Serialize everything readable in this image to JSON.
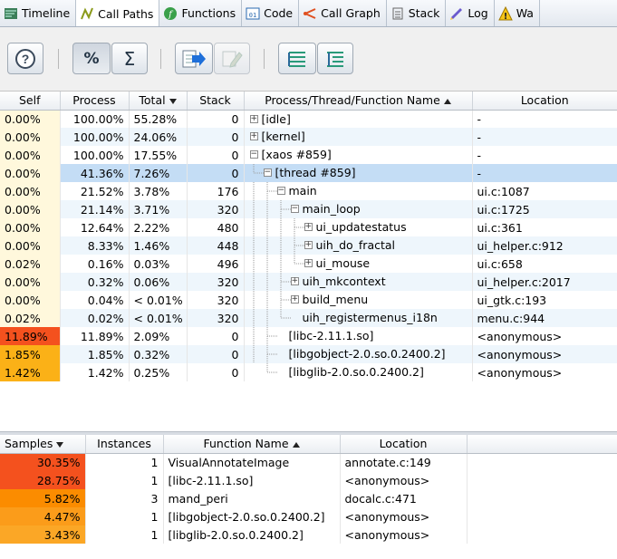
{
  "tabs": [
    {
      "label": "Timeline",
      "icon": "timeline-icon",
      "active": false
    },
    {
      "label": "Call Paths",
      "icon": "call-paths-icon",
      "active": true
    },
    {
      "label": "Functions",
      "icon": "functions-icon",
      "active": false
    },
    {
      "label": "Code",
      "icon": "code-icon",
      "active": false
    },
    {
      "label": "Call Graph",
      "icon": "call-graph-icon",
      "active": false
    },
    {
      "label": "Stack",
      "icon": "stack-icon",
      "active": false
    },
    {
      "label": "Log",
      "icon": "log-icon",
      "active": false
    },
    {
      "label": "Wa",
      "icon": "warning-icon",
      "active": false
    }
  ],
  "toolbar": {
    "percent_label": "%",
    "sum_label": "Σ"
  },
  "call_paths": {
    "columns": [
      "Self",
      "Process",
      "Total",
      "Stack",
      "Process/Thread/Function Name",
      "Location"
    ],
    "rows": [
      {
        "self": "0.00%",
        "process": "100.00%",
        "total": "55.28%",
        "stack": "0",
        "name": "[idle]",
        "location": "-",
        "depth": 0,
        "expander": "plus",
        "heat": "none"
      },
      {
        "self": "0.00%",
        "process": "100.00%",
        "total": "24.06%",
        "stack": "0",
        "name": "[kernel]",
        "location": "-",
        "depth": 0,
        "expander": "plus",
        "heat": "none"
      },
      {
        "self": "0.00%",
        "process": "100.00%",
        "total": "17.55%",
        "stack": "0",
        "name": "[xaos #859]",
        "location": "-",
        "depth": 0,
        "expander": "minus",
        "heat": "none"
      },
      {
        "self": "0.00%",
        "process": "41.36%",
        "total": "7.26%",
        "stack": "0",
        "name": "[thread #859]",
        "location": "-",
        "depth": 1,
        "expander": "minus",
        "heat": "none",
        "selected": true
      },
      {
        "self": "0.00%",
        "process": "21.52%",
        "total": "3.78%",
        "stack": "176",
        "name": "main",
        "location": "ui.c:1087",
        "depth": 2,
        "expander": "minus",
        "heat": "none"
      },
      {
        "self": "0.00%",
        "process": "21.14%",
        "total": "3.71%",
        "stack": "320",
        "name": "main_loop",
        "location": "ui.c:1725",
        "depth": 3,
        "expander": "minus",
        "heat": "none"
      },
      {
        "self": "0.00%",
        "process": "12.64%",
        "total": "2.22%",
        "stack": "480",
        "name": "ui_updatestatus",
        "location": "ui.c:361",
        "depth": 4,
        "expander": "plus",
        "heat": "none"
      },
      {
        "self": "0.00%",
        "process": "8.33%",
        "total": "1.46%",
        "stack": "448",
        "name": "uih_do_fractal",
        "location": "ui_helper.c:912",
        "depth": 4,
        "expander": "plus",
        "heat": "none"
      },
      {
        "self": "0.02%",
        "process": "0.16%",
        "total": "0.03%",
        "stack": "496",
        "name": "ui_mouse",
        "location": "ui.c:658",
        "depth": 4,
        "expander": "plus",
        "heat": "none"
      },
      {
        "self": "0.00%",
        "process": "0.32%",
        "total": "0.06%",
        "stack": "320",
        "name": "uih_mkcontext",
        "location": "ui_helper.c:2017",
        "depth": 3,
        "expander": "plus",
        "heat": "none"
      },
      {
        "self": "0.00%",
        "process": "0.04%",
        "total": "< 0.01%",
        "stack": "320",
        "name": "build_menu",
        "location": "ui_gtk.c:193",
        "depth": 3,
        "expander": "plus",
        "heat": "none"
      },
      {
        "self": "0.02%",
        "process": "0.02%",
        "total": "< 0.01%",
        "stack": "320",
        "name": "uih_registermenus_i18n",
        "location": "menu.c:944",
        "depth": 3,
        "expander": "none",
        "heat": "none"
      },
      {
        "self": "11.89%",
        "process": "11.89%",
        "total": "2.09%",
        "stack": "0",
        "name": "[libc-2.11.1.so]",
        "location": "<anonymous>",
        "depth": 2,
        "expander": "none",
        "heat": "red"
      },
      {
        "self": "1.85%",
        "process": "1.85%",
        "total": "0.32%",
        "stack": "0",
        "name": "[libgobject-2.0.so.0.2400.2]",
        "location": "<anonymous>",
        "depth": 2,
        "expander": "none",
        "heat": "orange"
      },
      {
        "self": "1.42%",
        "process": "1.42%",
        "total": "0.25%",
        "stack": "0",
        "name": "[libglib-2.0.so.0.2400.2]",
        "location": "<anonymous>",
        "depth": 2,
        "expander": "none",
        "heat": "orange"
      }
    ]
  },
  "functions": {
    "columns": [
      "Samples",
      "Instances",
      "Function Name",
      "Location"
    ],
    "rows": [
      {
        "samples": "30.35%",
        "instances": "1",
        "name": "VisualAnnotateImage",
        "location": "annotate.c:149",
        "heat": "#f4511e"
      },
      {
        "samples": "28.75%",
        "instances": "1",
        "name": "[libc-2.11.1.so]",
        "location": "<anonymous>",
        "heat": "#f4511e"
      },
      {
        "samples": "5.82%",
        "instances": "3",
        "name": "mand_peri",
        "location": "docalc.c:471",
        "heat": "#fb8c00"
      },
      {
        "samples": "4.47%",
        "instances": "1",
        "name": "[libgobject-2.0.so.0.2400.2]",
        "location": "<anonymous>",
        "heat": "#fb9c1a"
      },
      {
        "samples": "3.43%",
        "instances": "1",
        "name": "[libglib-2.0.so.0.2400.2]",
        "location": "<anonymous>",
        "heat": "#fba726"
      }
    ]
  },
  "colors": {
    "self_bg": "#fff8dc",
    "heat_red": "#f4511e",
    "heat_orange": "#fbb117",
    "selection": "#c4ddf5",
    "alt_row": "#eef6fc"
  }
}
